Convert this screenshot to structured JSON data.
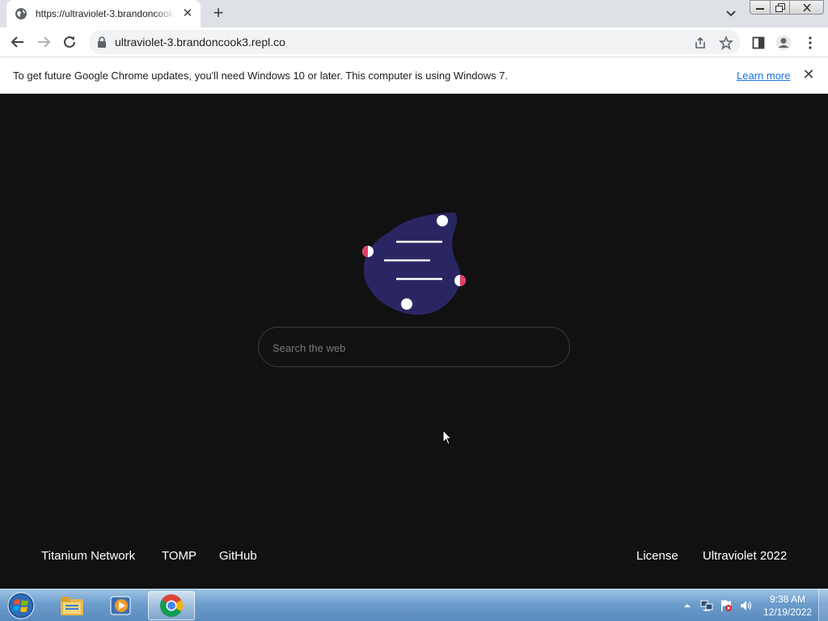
{
  "browser": {
    "tab": {
      "title": "https://ultraviolet-3.brandoncook3.repl.co",
      "favicon": "globe-icon"
    },
    "url": "ultraviolet-3.brandoncook3.repl.co"
  },
  "infobar": {
    "message": "To get future Google Chrome updates, you'll need Windows 10 or later. This computer is using Windows 7.",
    "link": "Learn more"
  },
  "page": {
    "search_placeholder": "Search the web",
    "footer_left": [
      "Titanium Network",
      "TOMP",
      "GitHub"
    ],
    "footer_right": [
      "License",
      "Ultraviolet 2022"
    ],
    "colors": {
      "background": "#111112",
      "logo_fill": "#2a2663",
      "logo_accent": "#e03e6b"
    }
  },
  "taskbar": {
    "time": "9:38 AM",
    "date": "12/19/2022",
    "items": [
      "start-orb",
      "explorer-icon",
      "media-player-icon",
      "chrome-icon"
    ]
  }
}
